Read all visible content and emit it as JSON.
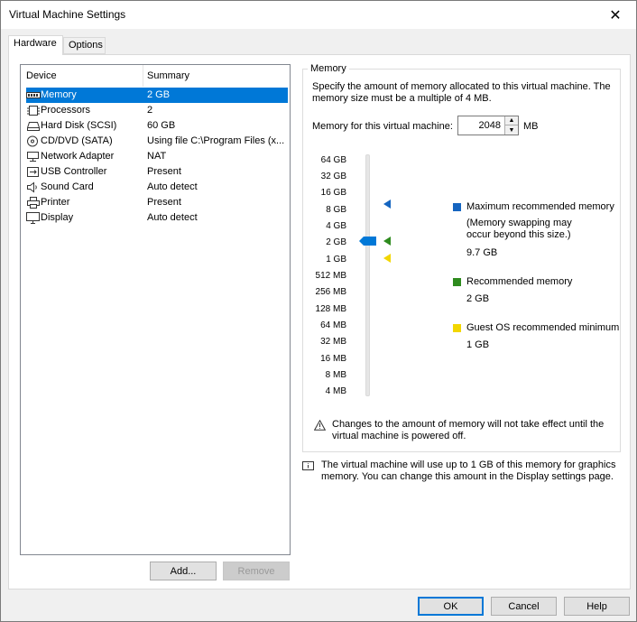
{
  "window": {
    "title": "Virtual Machine Settings"
  },
  "tabs": [
    {
      "label": "Hardware",
      "active": true
    },
    {
      "label": "Options",
      "active": false
    }
  ],
  "devices": {
    "header": {
      "device": "Device",
      "summary": "Summary"
    },
    "rows": [
      {
        "name": "Memory",
        "summary": "2 GB",
        "icon": "memory-icon",
        "selected": true
      },
      {
        "name": "Processors",
        "summary": "2",
        "icon": "processor-icon"
      },
      {
        "name": "Hard Disk (SCSI)",
        "summary": "60 GB",
        "icon": "hard-disk-icon"
      },
      {
        "name": "CD/DVD (SATA)",
        "summary": "Using file C:\\Program Files (x...",
        "icon": "cd-dvd-icon"
      },
      {
        "name": "Network Adapter",
        "summary": "NAT",
        "icon": "network-adapter-icon"
      },
      {
        "name": "USB Controller",
        "summary": "Present",
        "icon": "usb-icon"
      },
      {
        "name": "Sound Card",
        "summary": "Auto detect",
        "icon": "sound-card-icon"
      },
      {
        "name": "Printer",
        "summary": "Present",
        "icon": "printer-icon"
      },
      {
        "name": "Display",
        "summary": "Auto detect",
        "icon": "display-icon"
      }
    ],
    "add_label": "Add...",
    "remove_label": "Remove"
  },
  "memory": {
    "group_title": "Memory",
    "description": "Specify the amount of memory allocated to this virtual machine. The memory size must be a multiple of 4 MB.",
    "field_label": "Memory for this virtual machine:",
    "value": "2048",
    "unit": "MB",
    "scale": [
      "64 GB",
      "32 GB",
      "16 GB",
      "8 GB",
      "4 GB",
      "2 GB",
      "1 GB",
      "512 MB",
      "256 MB",
      "128 MB",
      "64 MB",
      "32 MB",
      "16 MB",
      "8 MB",
      "4 MB"
    ],
    "slider_value": "2 GB",
    "legend": [
      {
        "label": "Maximum recommended memory",
        "note": "(Memory swapping may occur beyond this size.)",
        "value": "9.7 GB",
        "color": "#1565c0"
      },
      {
        "label": "Recommended memory",
        "value": "2 GB",
        "color": "#2e8b1e"
      },
      {
        "label": "Guest OS recommended minimum",
        "value": "1 GB",
        "color": "#f2d600"
      }
    ],
    "warning": "Changes to the amount of memory will not take effect until the virtual machine is powered off.",
    "info": "The virtual machine will use up to 1 GB of this memory for graphics memory. You can change this amount in the Display settings page."
  },
  "footer": {
    "ok_label": "OK",
    "cancel_label": "Cancel",
    "help_label": "Help"
  },
  "colors": {
    "accent": "#0078d7",
    "selection": "#0078d7"
  }
}
